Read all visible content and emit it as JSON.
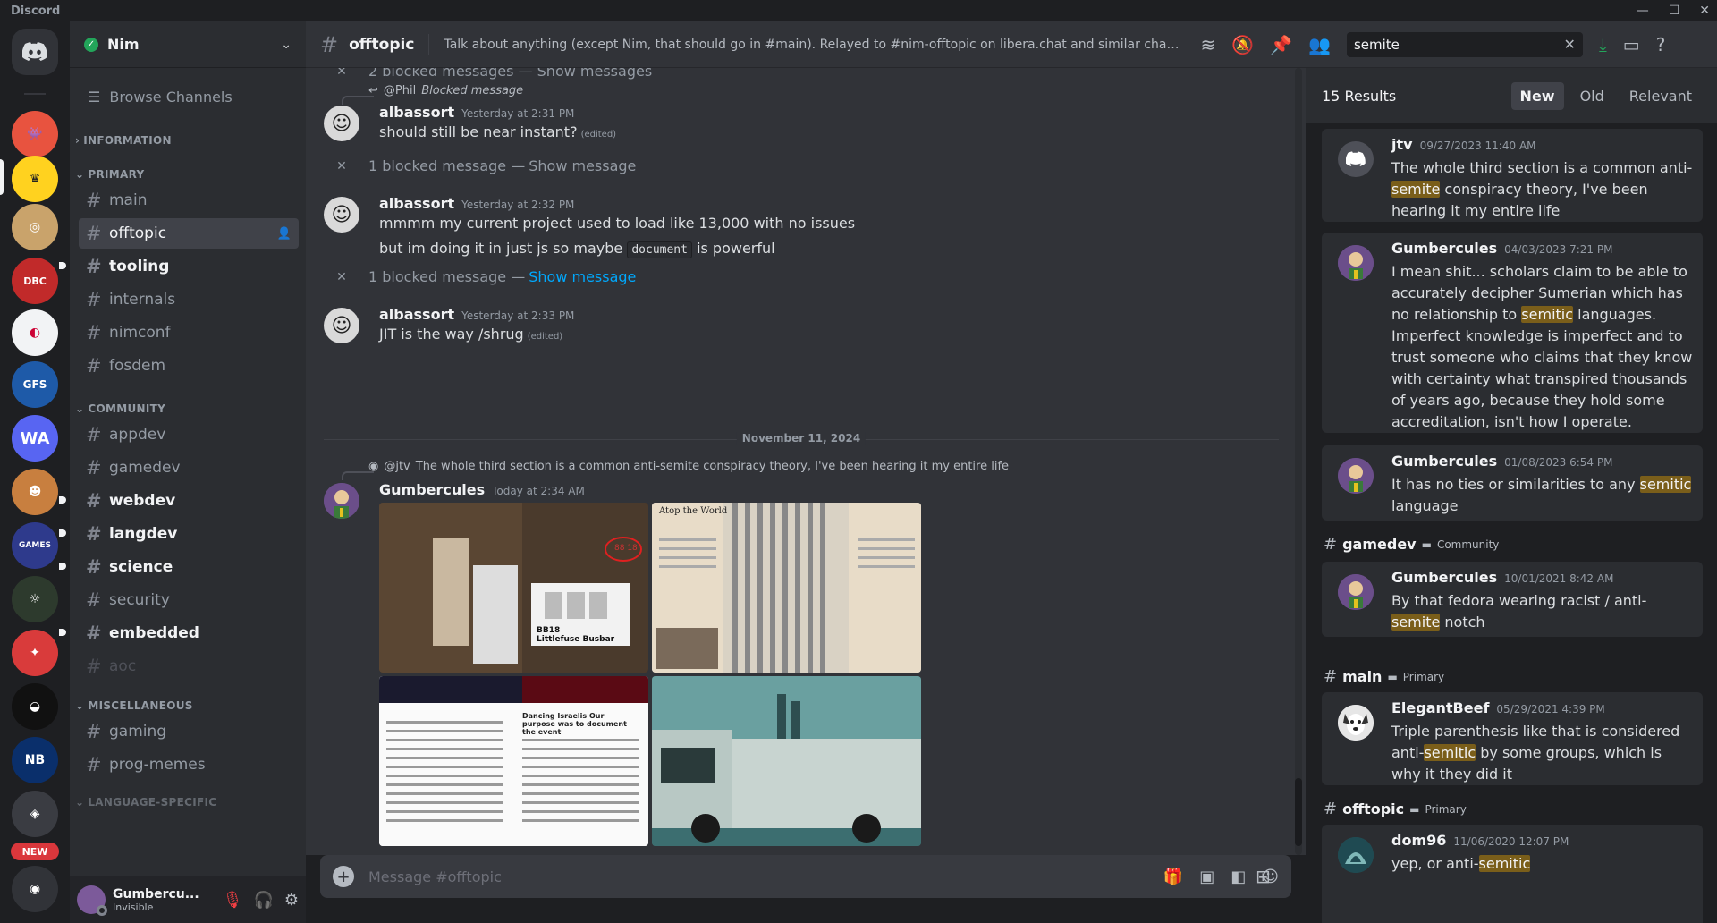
{
  "app": {
    "title": "Discord"
  },
  "window": {
    "minimize": "—",
    "maximize": "☐",
    "close": "✕"
  },
  "servers": {
    "new_badge": "NEW"
  },
  "guild": {
    "name": "Nim"
  },
  "sidebar": {
    "browse_label": "Browse Channels",
    "categories": {
      "information": "INFORMATION",
      "primary": "PRIMARY",
      "community": "COMMUNITY",
      "miscellaneous": "MISCELLANEOUS",
      "language_specific": "LANGUAGE-SPECIFIC"
    },
    "channels": {
      "main": "main",
      "offtopic": "offtopic",
      "tooling": "tooling",
      "internals": "internals",
      "nimconf": "nimconf",
      "fosdem": "fosdem",
      "appdev": "appdev",
      "gamedev": "gamedev",
      "webdev": "webdev",
      "langdev": "langdev",
      "science": "science",
      "security": "security",
      "embedded": "embedded",
      "aoc": "aoc",
      "gaming": "gaming",
      "prog_memes": "prog-memes"
    }
  },
  "user": {
    "name": "Gumbercu...",
    "status": "Invisible"
  },
  "header": {
    "channel": "offtopic",
    "topic": "Talk about anything (except Nim, that should go in #main). Relayed to #nim-offtopic on libera.chat and similar channel on ...",
    "search_value": "semite"
  },
  "chat": {
    "top_blocked": "2 blocked messages — Show messages",
    "reply1": {
      "user": "@Phil",
      "text": "Blocked message"
    },
    "msg1": {
      "author": "albassort",
      "time": "Yesterday at 2:31 PM",
      "text": "should still be near instant?",
      "edited": "(edited)"
    },
    "blocked1": {
      "text": "1 blocked message —",
      "link": "Show message"
    },
    "msg2": {
      "author": "albassort",
      "time": "Yesterday at 2:32 PM",
      "line1": "mmmm my current project used to load like 13,000 with no issues",
      "line2_pre": "but im doing it in just js so maybe",
      "line2_code": "document",
      "line2_post": "is powerful"
    },
    "blocked2": {
      "text": "1 blocked message —",
      "link": "Show message"
    },
    "msg3": {
      "author": "albassort",
      "time": "Yesterday at 2:33 PM",
      "text": "JIT is the way /shrug",
      "edited": "(edited)"
    },
    "date_divider": "November 11, 2024",
    "reply2": {
      "user": "@jtv",
      "text": "The whole third section is a common anti-semite conspiracy theory, I've been hearing it my entire life"
    },
    "msg4": {
      "author": "Gumbercules",
      "time": "Today at 2:34 AM"
    },
    "img_texts": {
      "busbar": "BB18\nLittlefuse Busbar",
      "atop": "Atop the World",
      "tag": "88 18",
      "dancing": "Dancing Israelis  Our purpose was to document the event"
    }
  },
  "composer": {
    "placeholder": "Message #offtopic"
  },
  "results": {
    "count": "15 Results",
    "sort": {
      "new": "New",
      "old": "Old",
      "relevant": "Relevant"
    },
    "items": [
      {
        "author": "jtv",
        "time": "09/27/2023 11:40 AM",
        "pre": "The whole third section is a common anti-",
        "hl": "semite",
        "post": " conspiracy theory, I've been hearing it my entire life"
      },
      {
        "author": "Gumbercules",
        "time": "04/03/2023 7:21 PM",
        "pre": "I mean shit... scholars claim to be able to accurately decipher Sumerian which has no relationship to ",
        "hl": "semitic",
        "post": " languages. Imperfect knowledge is imperfect and to trust someone who claims that they know with certainty what transpired thousands of years ago, because they hold some accreditation, isn't how I operate."
      },
      {
        "author": "Gumbercules",
        "time": "01/08/2023 6:54 PM",
        "pre": "It has no ties or similarities to any ",
        "hl": "semitic",
        "post": " language"
      },
      {
        "author": "Gumbercules",
        "time": "10/01/2021 8:42 AM",
        "pre": "By that fedora wearing racist / anti-",
        "hl": "semite",
        "post": " notch"
      },
      {
        "author": "ElegantBeef",
        "time": "05/29/2021 4:39 PM",
        "pre": "Triple parenthesis like that is considered anti-",
        "hl": "semitic",
        "post": " by some groups, which is why it they did it"
      },
      {
        "author": "dom96",
        "time": "11/06/2020 12:07 PM",
        "pre": "yep, or anti-",
        "hl": "semitic",
        "post": ""
      }
    ],
    "groups": [
      {
        "channel": "gamedev",
        "category": "Community"
      },
      {
        "channel": "main",
        "category": "Primary"
      },
      {
        "channel": "offtopic",
        "category": "Primary"
      }
    ]
  }
}
